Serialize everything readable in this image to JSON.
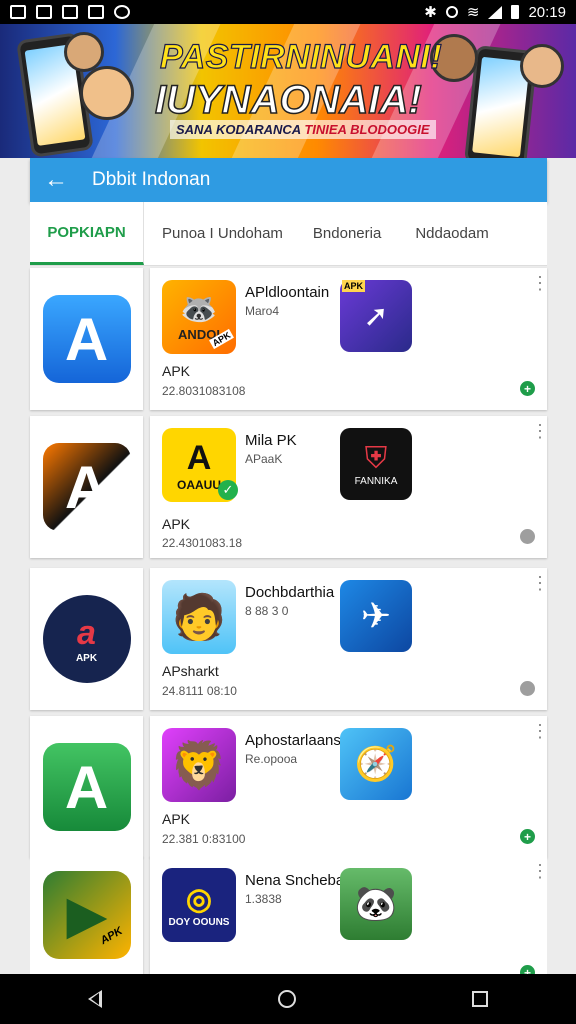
{
  "status_bar": {
    "time": "20:19"
  },
  "banner": {
    "title_line1": "PASTIRNINUANI!",
    "title_line2": "IUYNAONAIA!",
    "subtitle_a": "SANA KODARANCA",
    "subtitle_b": "TINIEA BLODOOGIE"
  },
  "appbar": {
    "title": "Dbbit Indonan"
  },
  "tabs": [
    {
      "label": "POPKIAPN",
      "active": true
    },
    {
      "label": "Punoa I Undoham"
    },
    {
      "label": "Bndoneria"
    },
    {
      "label": "Nddaodam"
    }
  ],
  "apps": [
    {
      "name": "APldloontain",
      "meta": "Maro4",
      "type": "APK",
      "date": "22.8031083108",
      "status": "add"
    },
    {
      "name": "Mila PK",
      "meta": "APaaK",
      "type": "APK",
      "date": "22.4301083.18",
      "status": "idle"
    },
    {
      "name": "Dochbdarthia",
      "meta": "8 88 3 0",
      "type": "APsharkt",
      "date": "24.8111 08:10",
      "status": "idle"
    },
    {
      "name": "Aphostarlaansan",
      "meta": "Re.opooa",
      "type": "APK",
      "date": "22.381 0:83100",
      "status": "add"
    },
    {
      "name": "Nena Snchebalinn",
      "meta": "1.3838",
      "type": "",
      "date": "",
      "status": "add"
    }
  ],
  "icon_labels": {
    "app1_icon": "ANDOI",
    "app1_badge": "APK",
    "app1b_corner": "APK",
    "app2_icon": "OAAUU",
    "app2b_icon": "FANNIKA",
    "left3_icon": "APK",
    "left5_badge": "APK",
    "app5_icon": "DOY OOUNS"
  },
  "colors": {
    "accent": "#2f9be2",
    "green": "#1f9d4a",
    "grey_dot": "#9e9e9e"
  }
}
